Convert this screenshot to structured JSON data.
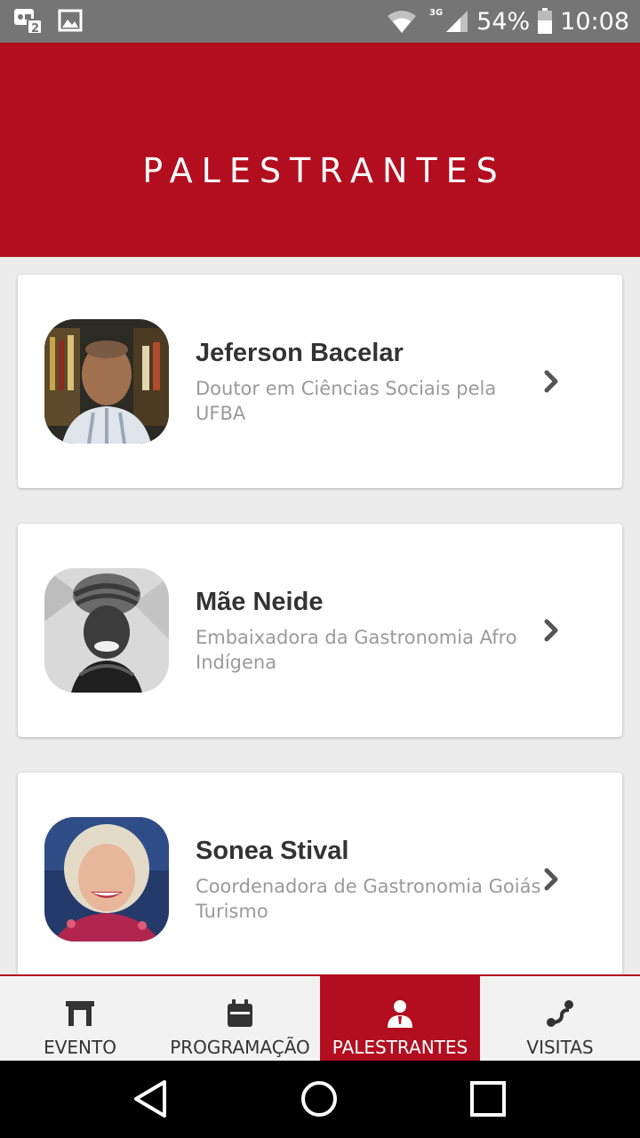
{
  "status_bar": {
    "battery_percent": "54%",
    "time": "10:08",
    "network": "3G",
    "icons": [
      "messaging-notification-icon",
      "image-notification-icon",
      "wifi-icon",
      "cell-signal-icon",
      "battery-icon"
    ]
  },
  "header": {
    "title": "PALESTRANTES"
  },
  "speakers": [
    {
      "name": "Jeferson Bacelar",
      "role": "Doutor em Ciências Sociais pela UFBA"
    },
    {
      "name": "Mãe Neide",
      "role": "Embaixadora da Gastronomia Afro Indígena"
    },
    {
      "name": "Sonea Stival",
      "role": "Coordenadora de Gastronomia Goiás Turismo"
    }
  ],
  "bottom_nav": {
    "items": [
      {
        "label": "EVENTO",
        "icon": "venue-icon"
      },
      {
        "label": "PROGRAMAÇÃO",
        "icon": "calendar-icon"
      },
      {
        "label": "PALESTRANTES",
        "icon": "speaker-icon",
        "active": true
      },
      {
        "label": "VISITAS",
        "icon": "route-icon"
      }
    ]
  },
  "colors": {
    "brand_red": "#b20e1f",
    "status_bar": "#757575"
  }
}
